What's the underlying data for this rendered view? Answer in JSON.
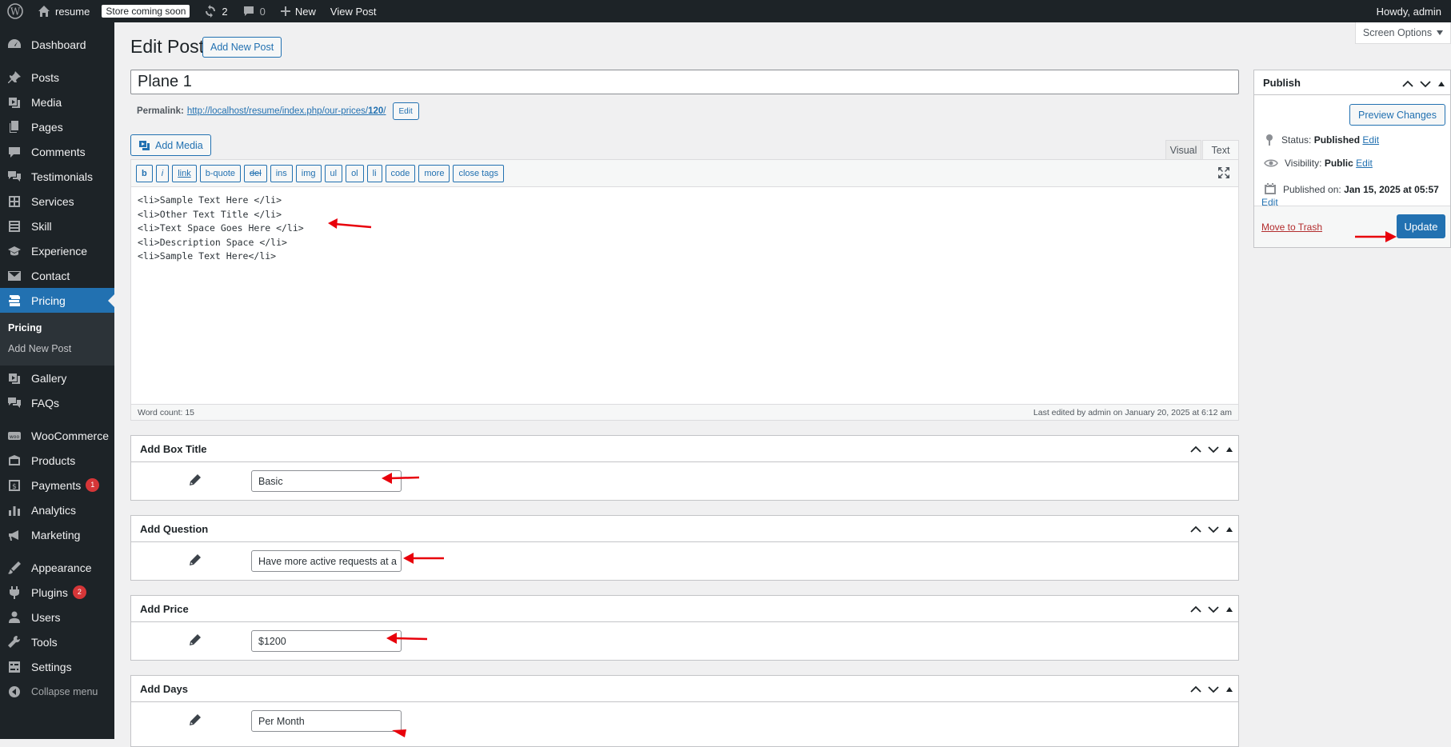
{
  "admin_bar": {
    "site_name": "resume",
    "store_badge": "Store coming soon",
    "updates_count": "2",
    "comments_count": "0",
    "new_label": "New",
    "view_post": "View Post",
    "howdy": "Howdy, admin"
  },
  "sidebar": {
    "items": [
      {
        "label": "Dashboard",
        "icon": "dashboard-icon"
      },
      {
        "label": "Posts",
        "icon": "pin-icon"
      },
      {
        "label": "Media",
        "icon": "media-icon"
      },
      {
        "label": "Pages",
        "icon": "pages-icon"
      },
      {
        "label": "Comments",
        "icon": "comment-icon"
      },
      {
        "label": "Testimonials",
        "icon": "testimonial-icon"
      },
      {
        "label": "Services",
        "icon": "grid-icon"
      },
      {
        "label": "Skill",
        "icon": "list-icon"
      },
      {
        "label": "Experience",
        "icon": "experience-icon"
      },
      {
        "label": "Contact",
        "icon": "mail-icon"
      },
      {
        "label": "Pricing",
        "icon": "pricing-icon"
      }
    ],
    "submenu": [
      "Pricing",
      "Add New Post"
    ],
    "items_after": [
      {
        "label": "Gallery",
        "icon": "gallery-icon"
      },
      {
        "label": "FAQs",
        "icon": "faq-icon"
      }
    ],
    "items_group2": [
      {
        "label": "WooCommerce",
        "icon": "woocommerce-icon"
      },
      {
        "label": "Products",
        "icon": "products-icon"
      },
      {
        "label": "Payments",
        "icon": "payments-icon",
        "badge": "1"
      },
      {
        "label": "Analytics",
        "icon": "analytics-icon"
      },
      {
        "label": "Marketing",
        "icon": "marketing-icon"
      }
    ],
    "items_group3": [
      {
        "label": "Appearance",
        "icon": "appearance-icon"
      },
      {
        "label": "Plugins",
        "icon": "plugins-icon",
        "badge": "2"
      },
      {
        "label": "Users",
        "icon": "users-icon"
      },
      {
        "label": "Tools",
        "icon": "tools-icon"
      },
      {
        "label": "Settings",
        "icon": "settings-icon"
      }
    ],
    "collapse": "Collapse menu"
  },
  "screen_options": "Screen Options",
  "page": {
    "title": "Edit Post",
    "add_new": "Add New Post",
    "post_title": "Plane 1",
    "permalink_label": "Permalink:",
    "permalink_url": "http://localhost/resume/index.php/our-prices/",
    "permalink_slug": "120",
    "permalink_tail": "/",
    "permalink_edit": "Edit"
  },
  "editor": {
    "add_media": "Add Media",
    "tab_visual": "Visual",
    "tab_text": "Text",
    "quicktags": [
      "b",
      "i",
      "link",
      "b-quote",
      "del",
      "ins",
      "img",
      "ul",
      "ol",
      "li",
      "code",
      "more",
      "close tags"
    ],
    "lines": [
      "<li>Sample Text Here </li>",
      "<li>Other Text Title </li>",
      "<li>Text Space Goes Here </li>",
      "<li>Description Space </li>",
      "<li>Sample Text Here</li>"
    ],
    "word_count": "Word count: 15",
    "last_edited": "Last edited by admin on January 20, 2025 at 6:12 am"
  },
  "metaboxes": [
    {
      "title": "Add Box Title",
      "value": "Basic"
    },
    {
      "title": "Add Question",
      "value": "Have more active requests at a"
    },
    {
      "title": "Add Price",
      "value": "$1200"
    },
    {
      "title": "Add Days",
      "value": "Per Month"
    }
  ],
  "publish": {
    "title": "Publish",
    "preview": "Preview Changes",
    "status_label": "Status:",
    "status_value": "Published",
    "visibility_label": "Visibility:",
    "visibility_value": "Public",
    "published_label": "Published on:",
    "published_value": "Jan 15, 2025 at 05:57",
    "edit": "Edit",
    "trash": "Move to Trash",
    "update": "Update"
  },
  "colors": {
    "accent": "#2271b1",
    "admin_dark": "#1d2327",
    "annotation_arrow": "#e8000b",
    "badge": "#d63638"
  }
}
